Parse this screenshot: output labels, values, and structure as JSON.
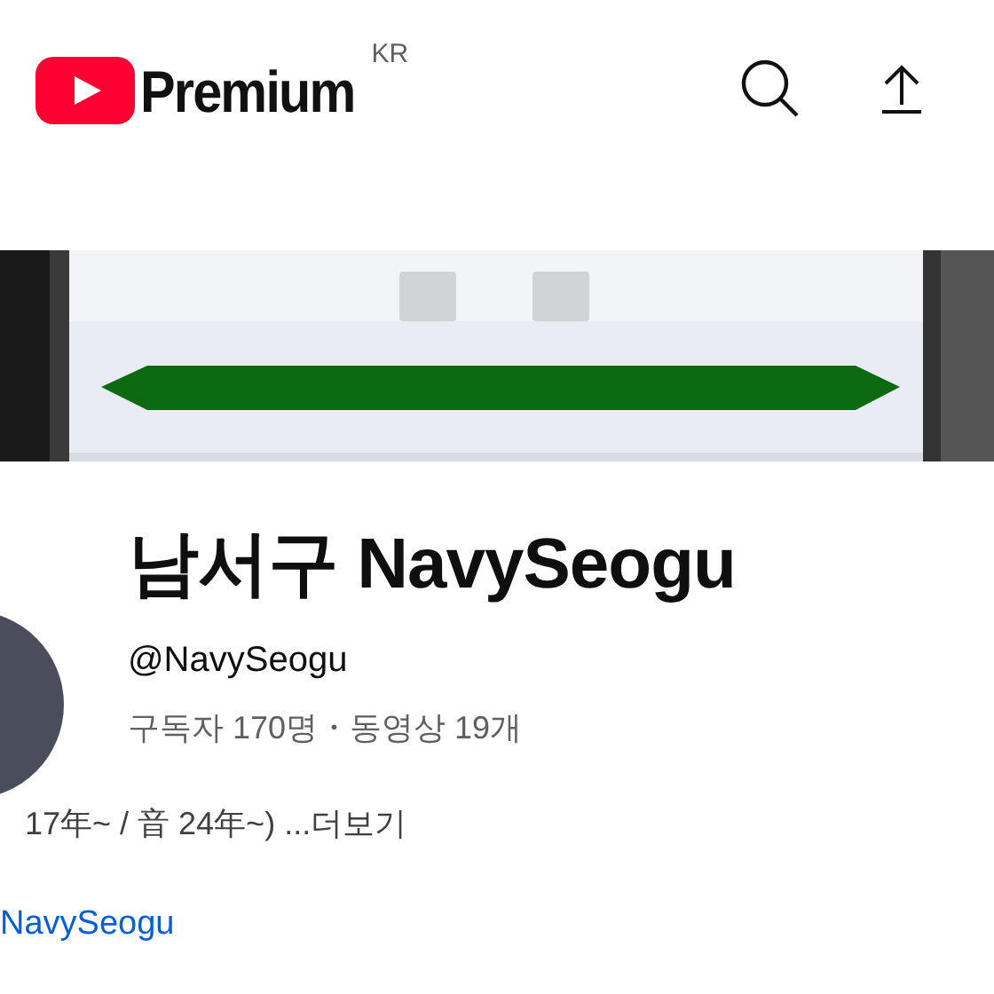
{
  "header": {
    "logo_text": "Premium",
    "region": "KR"
  },
  "channel": {
    "name": "남서구 NavySeogu",
    "handle": "@NavySeogu",
    "stats": "구독자 170명・동영상 19개",
    "description": "17年~ / 音 24年~) ...더보기",
    "link": "NavySeogu"
  }
}
